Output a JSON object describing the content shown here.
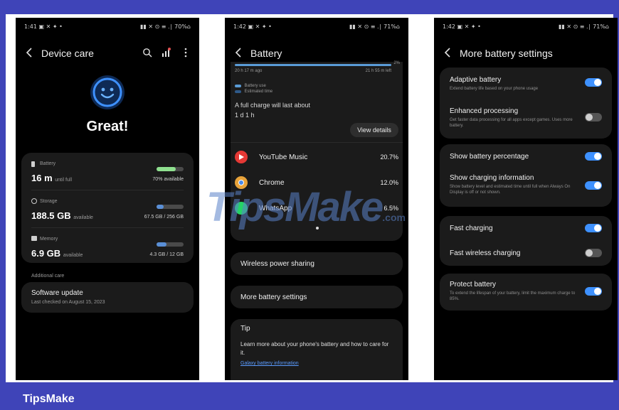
{
  "colors": {
    "frame": "#3f44b8",
    "accent": "#3e91ff",
    "battery_green": "#8fe08f",
    "storage_blue": "#5a8fd6",
    "memory_blue": "#5a8fd6"
  },
  "brand_label": "TipsMake",
  "watermark": {
    "text": "TipsMake",
    "suffix": ".com"
  },
  "screen1": {
    "status": {
      "time": "1:41",
      "icons": "▣ ✕ ✦ •",
      "right": "▮▮ ✕ ⊙ ≡ .∣ 70%⌂"
    },
    "title": "Device care",
    "toolbar_icons": [
      "search-icon",
      "chart-icon",
      "more-icon"
    ],
    "status_word": "Great!",
    "battery": {
      "label": "Battery",
      "value": "16 m",
      "unit": "until full",
      "right": "70% available",
      "level": 0.7
    },
    "storage": {
      "label": "Storage",
      "value": "188.5 GB",
      "unit": "available",
      "right": "67.5 GB / 256 GB",
      "level": 0.26
    },
    "memory": {
      "label": "Memory",
      "value": "6.9 GB",
      "unit": "available",
      "right": "4.3 GB / 12 GB",
      "level": 0.36
    },
    "section_header": "Additional care",
    "software_update": {
      "title": "Software update",
      "subtitle": "Last checked on August 15, 2023"
    }
  },
  "screen2": {
    "status": {
      "time": "1:42",
      "icons": "▣ ✕ ✦ •",
      "right": "▮▮ ✕ ⊙ ≡ .∣ 71%⌂"
    },
    "title": "Battery",
    "graph": {
      "left_label": "20 h 17 m ago",
      "right_label": "21 h 55 m left",
      "pct_label": "2%"
    },
    "legend": [
      "Battery use",
      "Estimated time"
    ],
    "full_charge": {
      "label": "A full charge will last about",
      "value": "1 d 1 h"
    },
    "view_details": "View details",
    "apps": [
      {
        "name": "YouTube Music",
        "pct": "20.7%",
        "color": "#e53935"
      },
      {
        "name": "Chrome",
        "pct": "12.0%",
        "color": "#e8a33a"
      },
      {
        "name": "WhatsApp",
        "pct": "6.5%",
        "color": "#25d366"
      }
    ],
    "wireless_power": "Wireless power sharing",
    "more_settings": "More battery settings",
    "tip": {
      "title": "Tip",
      "body": "Learn more about your phone's battery and how to care for it.",
      "link": "Galaxy battery information"
    }
  },
  "screen3": {
    "status": {
      "time": "1:42",
      "icons": "▣ ✕ ✦ •",
      "right": "▮▮ ✕ ⊙ ≡ .∣ 71%⌂"
    },
    "title": "More battery settings",
    "adaptive": {
      "title": "Adaptive battery",
      "sub": "Extend battery life based on your phone usage",
      "on": true
    },
    "enhanced": {
      "title": "Enhanced processing",
      "sub": "Get faster data processing for all apps except games. Uses more battery.",
      "on": false
    },
    "show_pct": {
      "title": "Show battery percentage",
      "on": true
    },
    "charging_info": {
      "title": "Show charging information",
      "sub": "Show battery level and estimated time until full when Always On Display is off or not shown.",
      "on": true
    },
    "fast_charging": {
      "title": "Fast charging",
      "on": true
    },
    "fast_wireless": {
      "title": "Fast wireless charging",
      "on": false
    },
    "protect": {
      "title": "Protect battery",
      "sub": "To extend the lifespan of your battery, limit the maximum charge to 85%.",
      "on": true
    }
  }
}
